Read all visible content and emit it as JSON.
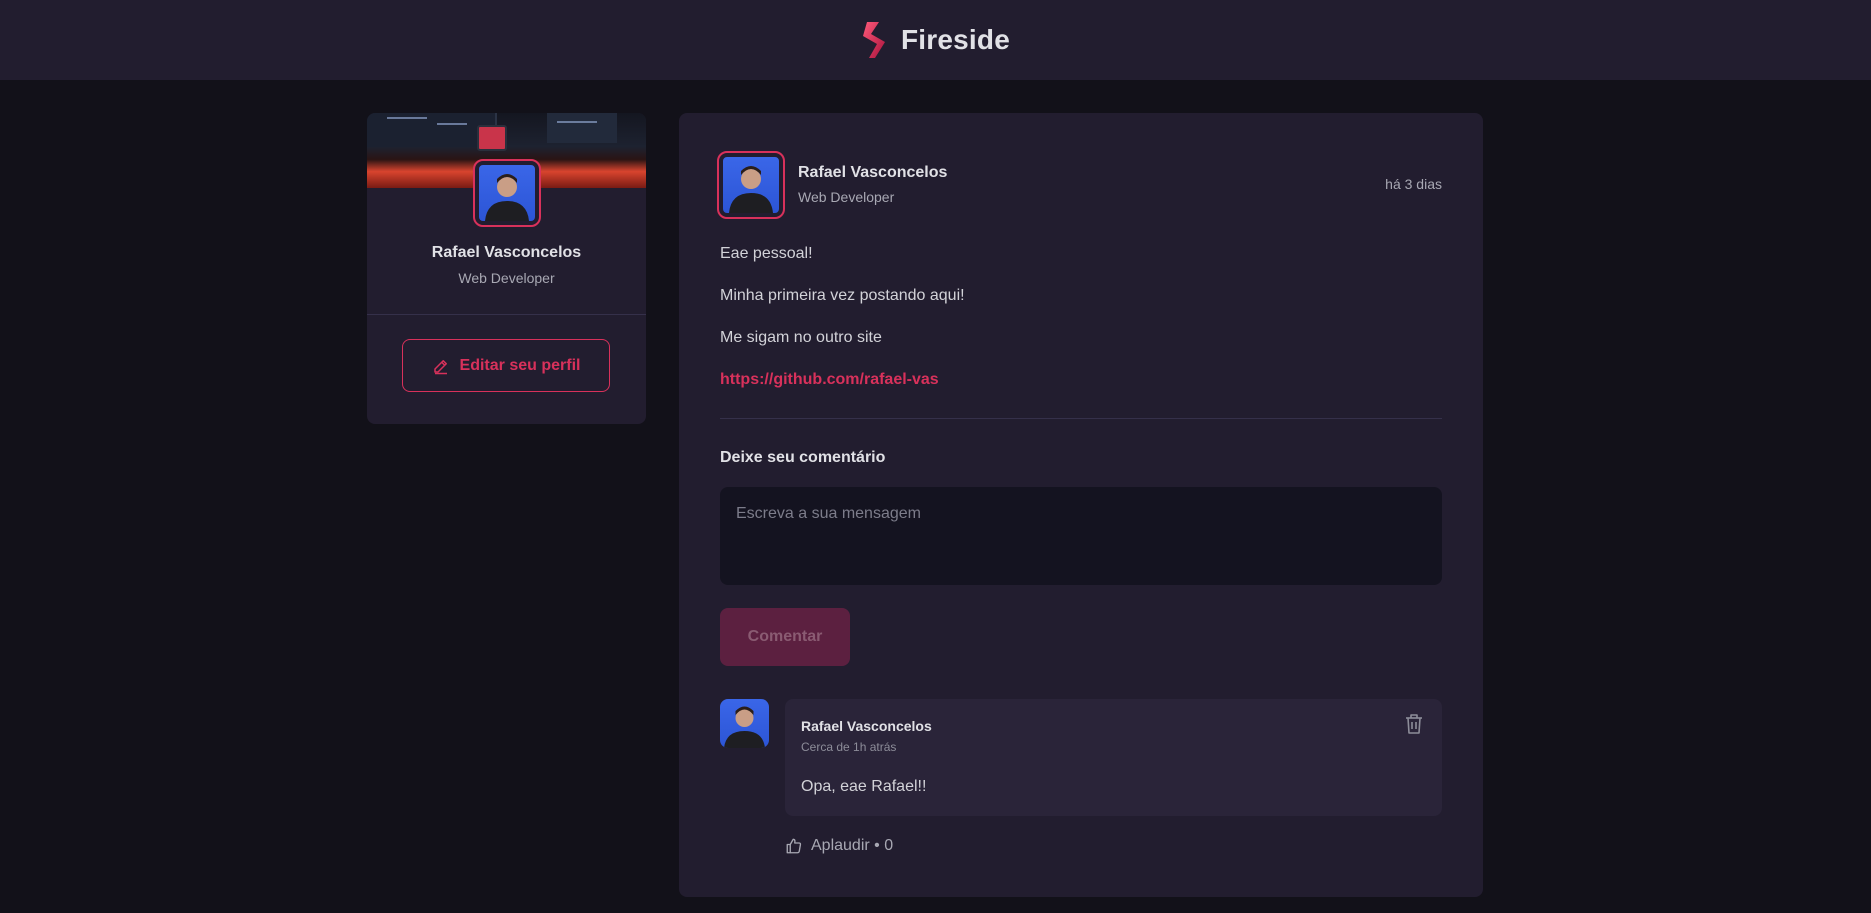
{
  "app": {
    "title": "Fireside"
  },
  "sidebar": {
    "name": "Rafael Vasconcelos",
    "role": "Web Developer",
    "edit_label": "Editar seu perfil"
  },
  "post": {
    "author": "Rafael Vasconcelos",
    "role": "Web Developer",
    "time": "há 3 dias",
    "paragraphs": [
      "Eae pessoal!",
      "Minha primeira vez postando aqui!",
      "Me sigam no outro site"
    ],
    "link": "https://github.com/rafael-vas"
  },
  "comment_form": {
    "heading": "Deixe seu comentário",
    "placeholder": "Escreva a sua mensagem",
    "submit_label": "Comentar"
  },
  "comments": [
    {
      "author": "Rafael Vasconcelos",
      "time": "Cerca de 1h atrás",
      "text": "Opa, eae Rafael!!",
      "applaud_label": "Aplaudir • 0"
    }
  ],
  "colors": {
    "accent": "#d8315b",
    "background": "#121119",
    "card": "#221d2f",
    "input": "#141320"
  },
  "icons": [
    "fireside-logo",
    "pencil-icon",
    "trash-icon",
    "thumbs-up-icon"
  ]
}
